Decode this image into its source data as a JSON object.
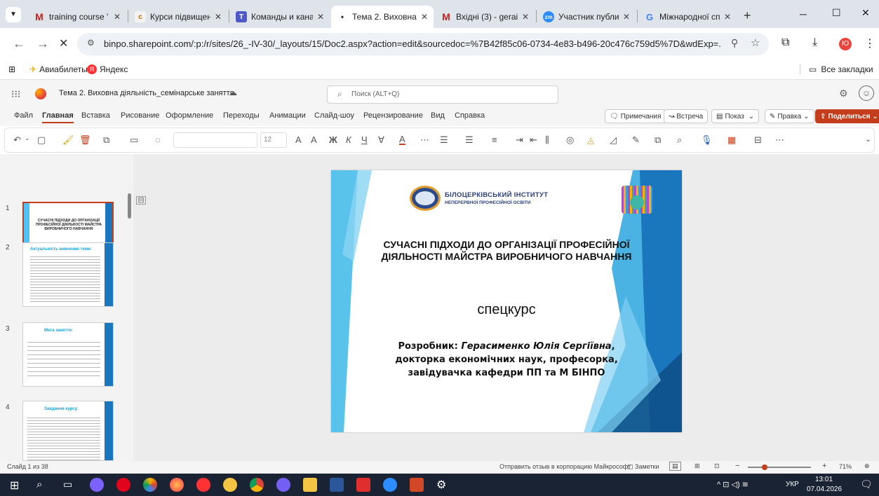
{
  "browser": {
    "tabs": [
      {
        "title": "training course '",
        "color": "#c5221f",
        "glyph": "M"
      },
      {
        "title": "Курси підвищен",
        "color": "#e8a23a",
        "glyph": "c"
      },
      {
        "title": "Команды и кана",
        "color": "#5059c9",
        "glyph": "T"
      },
      {
        "title": "Тема 2. Виховна",
        "color": "#c43e1c",
        "glyph": "•"
      },
      {
        "title": "Вхідні (3) - gerai",
        "color": "#c5221f",
        "glyph": "M"
      },
      {
        "title": "Участник публи",
        "color": "#2d8cff",
        "glyph": "zm"
      },
      {
        "title": "Міжнародної сп",
        "color": "#4285f4",
        "glyph": "G"
      }
    ],
    "new_tab": "+",
    "url": "binpo.sharepoint.com/:p:/r/sites/26_-IV-30/_layouts/15/Doc2.aspx?action=edit&sourcedoc=%7B42f85c06-0734-4e83-b496-20c476c759d5%7D&wdExp=...",
    "bookmarks": [
      "Авиабилеты",
      "Яндекс"
    ],
    "all_bookmarks": "Все закладки",
    "profile_letter": "Ю"
  },
  "office": {
    "doc_title": "Тема 2. Виховна діяльність_семінарське заняття",
    "search_placeholder": "Поиск (ALT+Q)",
    "menu": [
      "Файл",
      "Главная",
      "Вставка",
      "Рисование",
      "Оформление",
      "Переходы",
      "Анимации",
      "Слайд-шоу",
      "Рецензирование",
      "Вид",
      "Справка"
    ],
    "actions": {
      "comments": "Примечания",
      "meeting": "Встреча",
      "show": "Показ",
      "edit": "Правка",
      "share": "Поделиться"
    },
    "font_size": "12"
  },
  "slide": {
    "institute_line1": "БІЛОЦЕРКІВСЬКИЙ ІНСТИТУТ",
    "institute_line2": "НЕПЕРЕРВНОЇ ПРОФЕСІЙНОЇ ОСВІТИ",
    "title": "СУЧАСНІ ПІДХОДИ ДО ОРГАНІЗАЦІЇ ПРОФЕСІЙНОЇ ДІЯЛЬНОСТІ МАЙСТРА ВИРОБНИЧОГО НАВЧАННЯ",
    "subtitle": "спецкурс",
    "author_label": "Розробник:",
    "author_name": "Герасименко Юлія Сергіївна",
    "author_details": "докторка економічних наук, професорка, завідувачка кафедри ПП та М БІНПО"
  },
  "thumbnails": [
    {
      "num": "1",
      "title": "СУЧАСНІ ПІДХОДИ ДО ОРГАНІЗАЦІЇ ПРОФЕСІЙНОЇ ДІЯЛЬНОСТІ МАЙСТРА ВИРОБНИЧОГО НАВЧАННЯ"
    },
    {
      "num": "2",
      "title": "Актуальність вивчення теми:"
    },
    {
      "num": "3",
      "title": "Мета заняття:"
    },
    {
      "num": "4",
      "title": "Завдання курсу:"
    }
  ],
  "status": {
    "slide_of": "Слайд 1 из 38",
    "feedback": "Отправить отзыв в корпорацию Майкрософт",
    "notes": "Заметки",
    "zoom": "71%"
  },
  "taskbar": {
    "lang": "УКР",
    "time": "13:01",
    "date": "07.04.2026"
  }
}
